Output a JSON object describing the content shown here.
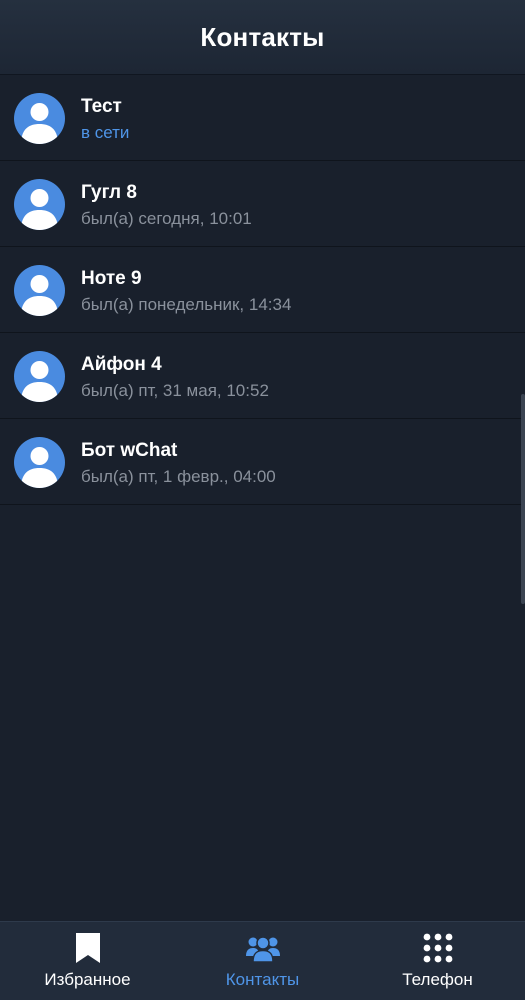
{
  "header": {
    "title": "Контакты"
  },
  "contacts": [
    {
      "name": "Тест",
      "status": "в сети",
      "online": true
    },
    {
      "name": "Гугл 8",
      "status": "был(а) сегодня, 10:01",
      "online": false
    },
    {
      "name": "Ноте 9",
      "status": "был(а) понедельник, 14:34",
      "online": false
    },
    {
      "name": "Айфон 4",
      "status": "был(а) пт, 31 мая, 10:52",
      "online": false
    },
    {
      "name": "Бот wChat",
      "status": "был(а) пт, 1 февр., 04:00",
      "online": false
    }
  ],
  "tabs": [
    {
      "label": "Избранное",
      "icon": "bookmark-icon",
      "active": false
    },
    {
      "label": "Контакты",
      "icon": "contacts-icon",
      "active": true
    },
    {
      "label": "Телефон",
      "icon": "dialpad-icon",
      "active": false
    }
  ],
  "colors": {
    "background": "#19202c",
    "accent": "#4f95e8",
    "avatar": "#4a8be0",
    "muted_text": "#8a919c"
  }
}
